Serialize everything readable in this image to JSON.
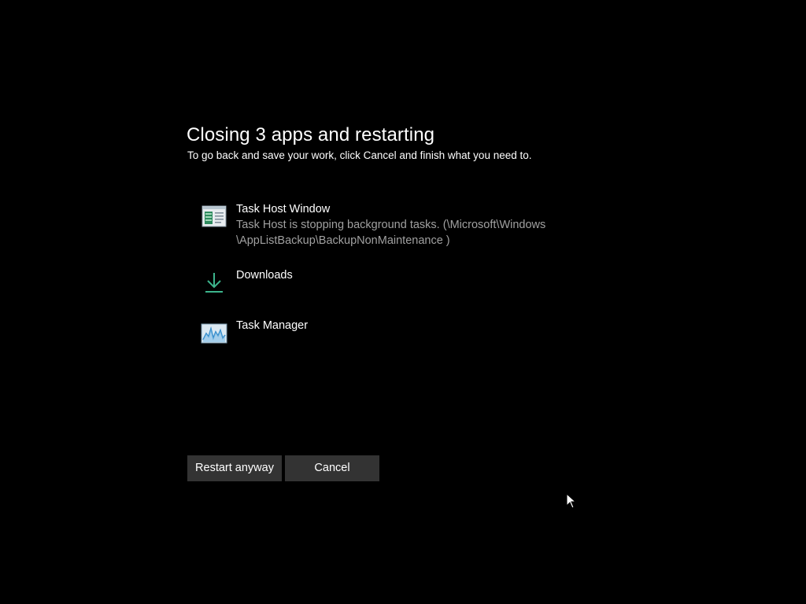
{
  "dialog": {
    "title": "Closing 3 apps and restarting",
    "subtitle": "To go back and save your work, click Cancel and finish what you need to."
  },
  "apps": [
    {
      "name": "Task Host Window",
      "description_line1": "Task Host is stopping background tasks. (\\Microsoft\\Windows",
      "description_line2": "\\AppListBackup\\BackupNonMaintenance )",
      "icon": "task-host-window-icon"
    },
    {
      "name": "Downloads",
      "icon": "download-arrow-icon"
    },
    {
      "name": "Task Manager",
      "icon": "task-manager-icon"
    }
  ],
  "buttons": {
    "restart_label": "Restart anyway",
    "cancel_label": "Cancel"
  },
  "colors": {
    "background": "#000000",
    "text": "#ffffff",
    "secondary_text": "#a0a0a0",
    "button_background": "#333333",
    "download_icon": "#3cb48c"
  }
}
